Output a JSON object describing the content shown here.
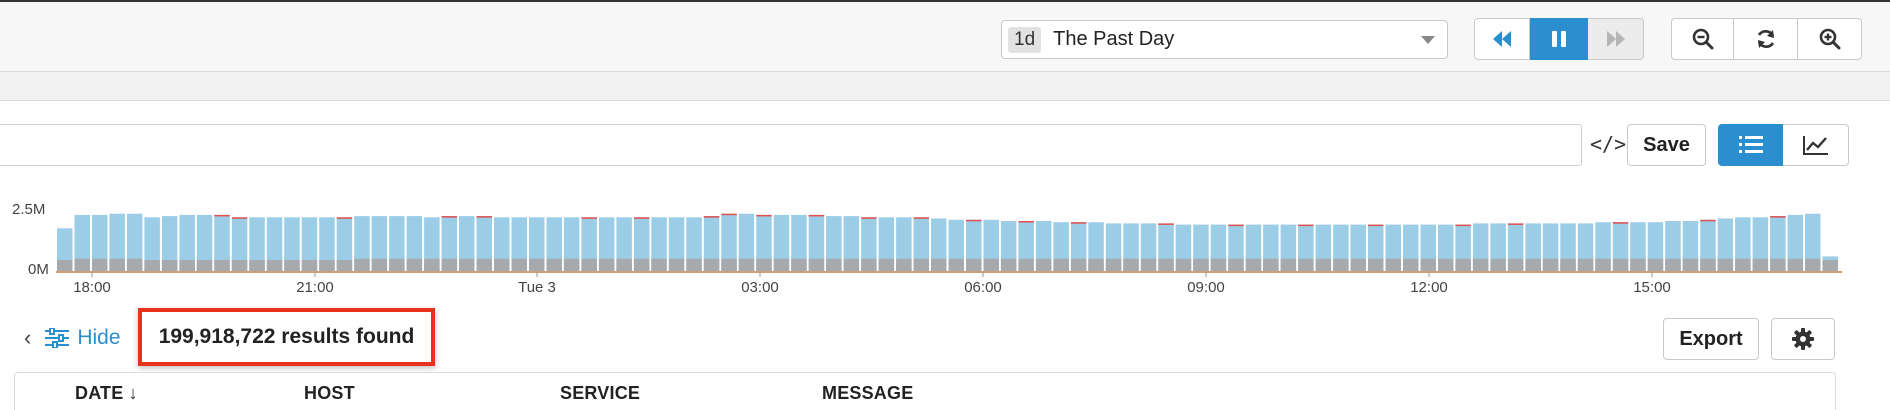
{
  "time_range": {
    "badge": "1d",
    "label": "The Past Day"
  },
  "playback": {
    "rewind": "rewind-icon",
    "pause": "pause-icon",
    "forward": "fast-forward-icon"
  },
  "zoom": {
    "zoom_out": "zoom-out-icon",
    "refresh": "refresh-icon",
    "zoom_in": "zoom-in-icon"
  },
  "query": {
    "placeholder": "",
    "code_toggle": "</>",
    "save_label": "Save"
  },
  "view_modes": {
    "list": "list-icon",
    "chart": "line-chart-icon"
  },
  "colors": {
    "accent": "#2b8fcf",
    "bar_light": "#9ccde6",
    "bar_dark": "#a6a9ad",
    "highlight": "#e8321e"
  },
  "chart_data": {
    "type": "bar",
    "yticks": [
      "2.5M",
      "0M"
    ],
    "xticks": [
      "18:00",
      "21:00",
      "Tue 3",
      "03:00",
      "06:00",
      "09:00",
      "12:00",
      "15:00"
    ],
    "ylim": [
      0,
      2.7
    ],
    "values": [
      1.75,
      2.3,
      2.3,
      2.35,
      2.35,
      2.2,
      2.25,
      2.3,
      2.3,
      2.3,
      2.2,
      2.2,
      2.2,
      2.2,
      2.2,
      2.2,
      2.2,
      2.25,
      2.25,
      2.25,
      2.25,
      2.2,
      2.25,
      2.25,
      2.25,
      2.2,
      2.2,
      2.2,
      2.2,
      2.2,
      2.2,
      2.2,
      2.2,
      2.2,
      2.2,
      2.2,
      2.2,
      2.25,
      2.35,
      2.35,
      2.3,
      2.3,
      2.3,
      2.3,
      2.25,
      2.25,
      2.2,
      2.2,
      2.2,
      2.2,
      2.15,
      2.1,
      2.1,
      2.1,
      2.05,
      2.05,
      2.05,
      2.0,
      2.0,
      2.0,
      1.95,
      1.95,
      1.95,
      1.95,
      1.9,
      1.9,
      1.9,
      1.9,
      1.9,
      1.9,
      1.9,
      1.9,
      1.9,
      1.9,
      1.9,
      1.9,
      1.9,
      1.9,
      1.9,
      1.9,
      1.9,
      1.95,
      1.95,
      1.95,
      1.95,
      1.95,
      1.95,
      1.95,
      2.0,
      2.0,
      2.0,
      2.0,
      2.05,
      2.05,
      2.1,
      2.15,
      2.2,
      2.2,
      2.25,
      2.3,
      2.35,
      0.6
    ],
    "base_values": [
      0.45,
      0.5,
      0.5,
      0.5,
      0.5,
      0.45,
      0.45,
      0.45,
      0.45,
      0.45,
      0.45,
      0.45,
      0.45,
      0.45,
      0.45,
      0.45,
      0.45,
      0.5,
      0.5,
      0.5,
      0.5,
      0.5,
      0.5,
      0.5,
      0.5,
      0.5,
      0.5,
      0.5,
      0.5,
      0.5,
      0.5,
      0.5,
      0.5,
      0.5,
      0.5,
      0.5,
      0.5,
      0.5,
      0.5,
      0.5,
      0.5,
      0.5,
      0.5,
      0.5,
      0.5,
      0.5,
      0.5,
      0.5,
      0.5,
      0.5,
      0.5,
      0.5,
      0.5,
      0.5,
      0.5,
      0.5,
      0.5,
      0.5,
      0.5,
      0.5,
      0.5,
      0.5,
      0.5,
      0.5,
      0.5,
      0.5,
      0.5,
      0.5,
      0.5,
      0.5,
      0.5,
      0.5,
      0.5,
      0.5,
      0.5,
      0.5,
      0.5,
      0.5,
      0.5,
      0.5,
      0.5,
      0.5,
      0.5,
      0.5,
      0.5,
      0.5,
      0.5,
      0.5,
      0.5,
      0.5,
      0.5,
      0.5,
      0.5,
      0.5,
      0.5,
      0.5,
      0.5,
      0.5,
      0.5,
      0.5,
      0.5,
      0.45
    ],
    "error_marks": [
      9,
      10,
      16,
      22,
      24,
      30,
      33,
      37,
      38,
      40,
      43,
      46,
      49,
      52,
      55,
      58,
      63,
      67,
      71,
      75,
      80,
      83,
      89,
      94,
      98
    ]
  },
  "results": {
    "hide_label": "Hide",
    "count_text": "199,918,722 results found"
  },
  "actions": {
    "export_label": "Export",
    "settings": "gear-icon"
  },
  "table": {
    "columns": [
      {
        "label": "DATE ↓"
      },
      {
        "label": "HOST"
      },
      {
        "label": "SERVICE"
      },
      {
        "label": "MESSAGE"
      }
    ]
  }
}
